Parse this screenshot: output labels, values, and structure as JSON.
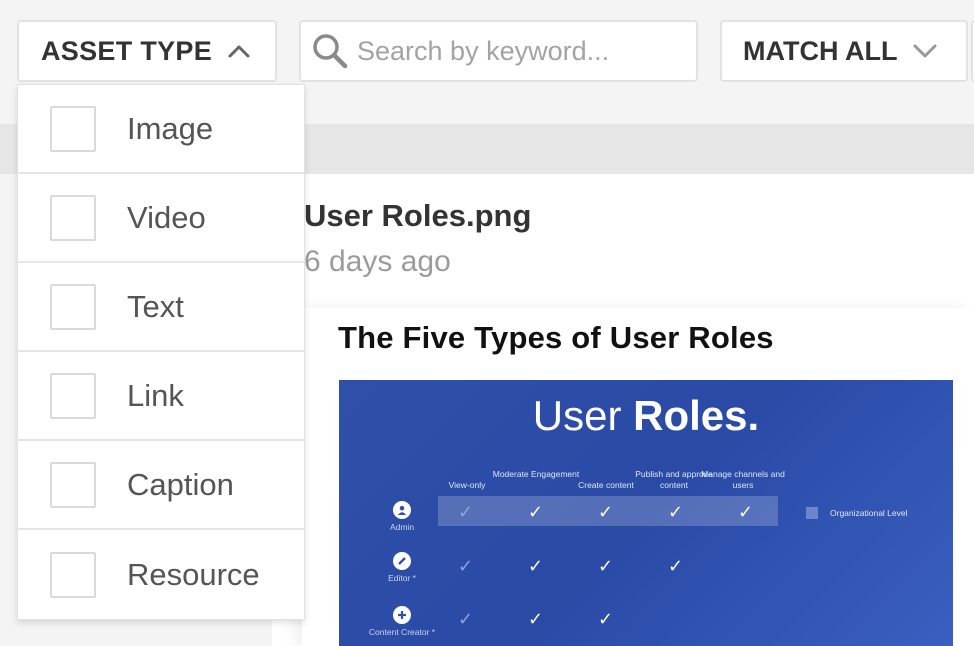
{
  "toolbar": {
    "asset_type_label": "ASSET TYPE",
    "search_placeholder": "Search by keyword...",
    "match_label": "MATCH ALL"
  },
  "dropdown": {
    "options": [
      {
        "label": "Image",
        "checked": false
      },
      {
        "label": "Video",
        "checked": false
      },
      {
        "label": "Text",
        "checked": false
      },
      {
        "label": "Link",
        "checked": false
      },
      {
        "label": "Caption",
        "checked": false
      },
      {
        "label": "Resource",
        "checked": false
      }
    ]
  },
  "asset": {
    "title": "User Roles.png",
    "date": "6 days ago",
    "preview_heading": "The Five Types of User Roles",
    "slide": {
      "title_light": "User ",
      "title_bold": "Roles.",
      "columns": [
        "View-only",
        "Moderate Engagement",
        "Create content",
        "Publish and approve content",
        "Manage channels and users"
      ],
      "roles": [
        "Admin",
        "Editor *",
        "Content Creator *"
      ],
      "legend": "Organizational Level"
    }
  },
  "colors": {
    "slide_blue": "#2f50a8",
    "border": "#e2e2e2",
    "text_dark": "#333333",
    "text_muted": "#9b9b9b"
  }
}
